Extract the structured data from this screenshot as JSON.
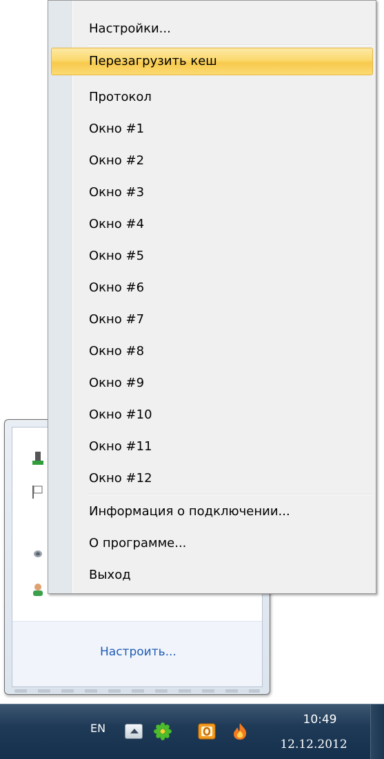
{
  "context_menu": {
    "items": [
      {
        "label": "Настройки..."
      },
      {
        "label": "Перезагрузить кеш",
        "highlighted": true
      },
      {
        "label": "Протокол"
      },
      {
        "label": "Окно #1"
      },
      {
        "label": "Окно #2"
      },
      {
        "label": "Окно #3"
      },
      {
        "label": "Окно #4"
      },
      {
        "label": "Окно #5"
      },
      {
        "label": "Окно #6"
      },
      {
        "label": "Окно #7"
      },
      {
        "label": "Окно #8"
      },
      {
        "label": "Окно #9"
      },
      {
        "label": "Окно #10"
      },
      {
        "label": "Окно #11"
      },
      {
        "label": "Окно #12"
      },
      {
        "label": "Информация о подключении..."
      },
      {
        "label": "О программе..."
      },
      {
        "label": "Выход"
      }
    ]
  },
  "tray_flyout": {
    "customize_label": "Настроить..."
  },
  "taskbar": {
    "language": "EN",
    "time": "10:49",
    "date": "12.12.2012",
    "icons": [
      "show-hidden-icons",
      "icq-icon",
      "outlook-icon",
      "flame-icon"
    ]
  },
  "colors": {
    "highlight": "#fbd96d",
    "menu_background": "#f0f0f0",
    "taskbar": "#1f3a57",
    "link": "#1e5ab4"
  }
}
